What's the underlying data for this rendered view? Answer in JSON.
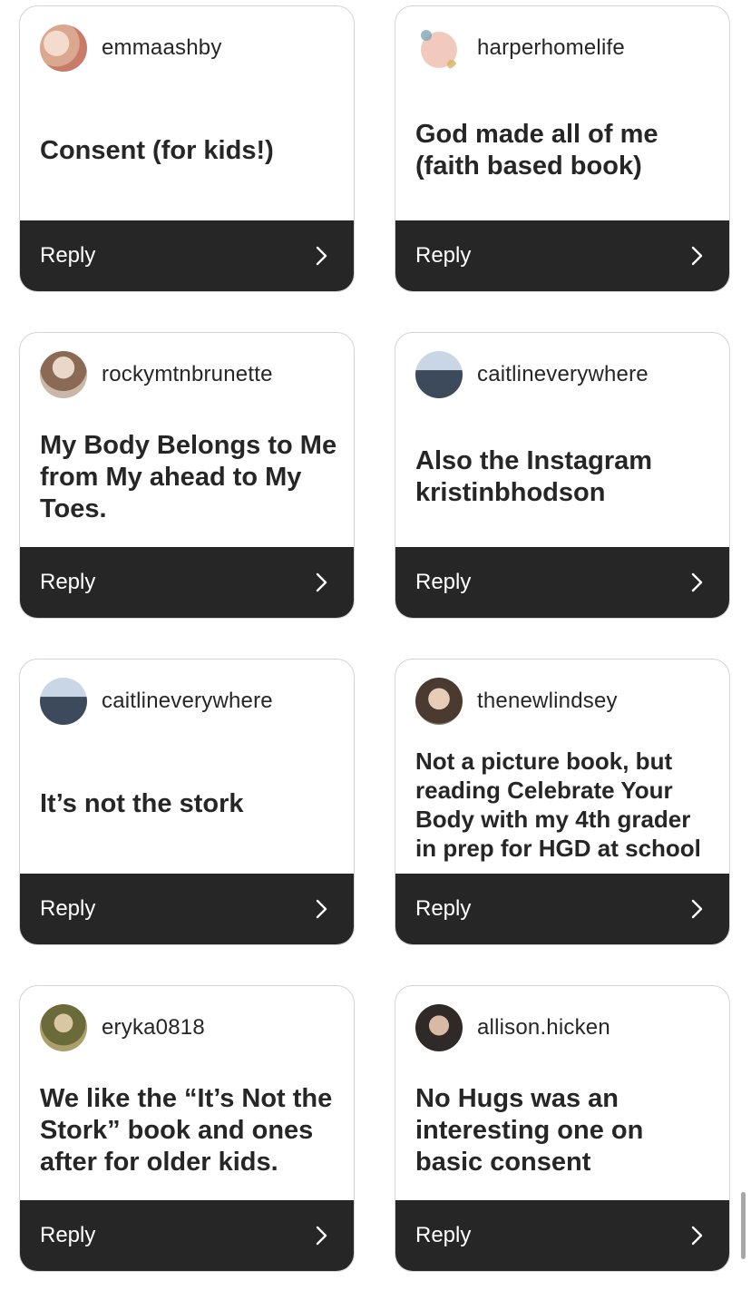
{
  "reply_label": "Reply",
  "cards": [
    {
      "username": "emmaashby",
      "text": "Consent (for kids!)"
    },
    {
      "username": "harperhomelife",
      "text": "God made all of me (faith based book)"
    },
    {
      "username": "rockymtnbrunette",
      "text": "My Body Belongs to Me from My ahead to My Toes."
    },
    {
      "username": "caitlineverywhere",
      "text": "Also the Instagram kristinbhodson"
    },
    {
      "username": "caitlineverywhere",
      "text": "It’s not the stork"
    },
    {
      "username": "thenewlindsey",
      "text": "Not a picture book, but reading Celebrate Your Body with my 4th grader in prep for HGD at school"
    },
    {
      "username": "eryka0818",
      "text": "We like the “It’s Not the Stork” book and ones after for older kids."
    },
    {
      "username": "allison.hicken",
      "text": "No Hugs was an interesting one on basic consent"
    }
  ],
  "colors": {
    "reply_bar": "#262626",
    "text": "#262626",
    "border": "#d4d4d4"
  }
}
